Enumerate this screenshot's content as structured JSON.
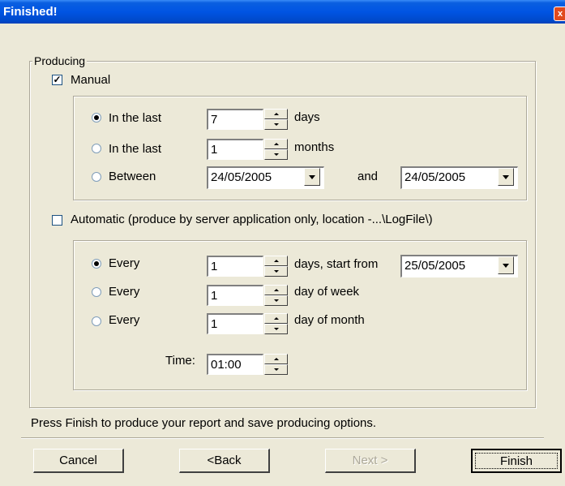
{
  "window": {
    "title": "Finished!",
    "close_glyph": "x"
  },
  "producing": {
    "legend": "Producing",
    "manual": {
      "label": "Manual",
      "checked": true,
      "options": [
        {
          "label": "In the last",
          "value": "7",
          "unit": "days",
          "selected": true
        },
        {
          "label": "In the last",
          "value": "1",
          "unit": "months",
          "selected": false
        }
      ],
      "between": {
        "label": "Between",
        "from": "24/05/2005",
        "and_label": "and",
        "to": "24/05/2005",
        "selected": false
      }
    },
    "automatic": {
      "label": "Automatic (produce by server application only, location -...\\LogFile\\)",
      "checked": false,
      "options": [
        {
          "label": "Every",
          "value": "1",
          "unit": "days, start from",
          "selected": true,
          "start_date": "25/05/2005"
        },
        {
          "label": "Every",
          "value": "1",
          "unit": "day of week",
          "selected": false
        },
        {
          "label": "Every",
          "value": "1",
          "unit": "day of month",
          "selected": false
        }
      ],
      "time": {
        "label": "Time:",
        "value": "01:00"
      }
    }
  },
  "instruction": "Press Finish to produce your report and save producing options.",
  "buttons": {
    "cancel": "Cancel",
    "back": "<Back",
    "next": "Next >",
    "finish": "Finish"
  },
  "colors": {
    "dialog_bg": "#ece9d8",
    "titlebar": "#0054e3",
    "disabled_text": "#aca899"
  }
}
